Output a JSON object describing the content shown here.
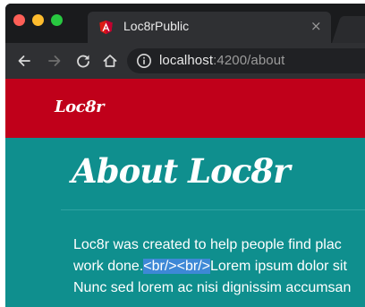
{
  "browser": {
    "tab": {
      "title": "Loc8rPublic",
      "close_glyph": "×",
      "favicon": "angular-icon"
    },
    "toolbar": {
      "back_icon": "back-arrow-icon",
      "forward_icon": "forward-arrow-icon",
      "reload_icon": "reload-icon",
      "home_icon": "home-icon",
      "info_icon": "info-icon"
    },
    "url": {
      "host": "localhost",
      "path": ":4200/about"
    }
  },
  "site": {
    "brand": "Loc8r",
    "heading": "About Loc8r",
    "paragraph": {
      "line1": "Loc8r was created to help people find plac",
      "line2_before": "work done.",
      "line2_selected": "<br/><br/>",
      "line2_after": "Lorem ipsum dolor sit",
      "line3": "Nunc sed lorem ac nisi dignissim accumsan"
    }
  },
  "colors": {
    "navbar": "#c0001a",
    "content_bg": "#0f8f8e",
    "selection": "#3d88d6",
    "chrome_dark": "#2f3033"
  }
}
